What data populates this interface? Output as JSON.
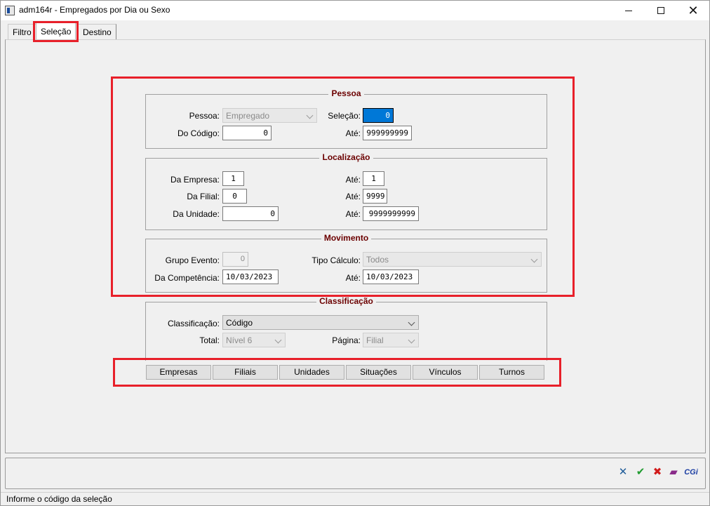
{
  "window": {
    "title": "adm164r - Empregados por Dia ou Sexo"
  },
  "tabs": [
    "Filtro",
    "Seleção",
    "Destino"
  ],
  "pessoa": {
    "title": "Pessoa",
    "pessoa_label": "Pessoa:",
    "pessoa_value": "Empregado",
    "selecao_label": "Seleção:",
    "selecao_value": "0",
    "do_codigo_label": "Do Código:",
    "do_codigo_value": "0",
    "ate_label": "Até:",
    "ate_value": "999999999"
  },
  "localizacao": {
    "title": "Localização",
    "da_empresa_label": "Da Empresa:",
    "da_empresa_value": "1",
    "ate_empresa_label": "Até:",
    "ate_empresa_value": "1",
    "da_filial_label": "Da Filial:",
    "da_filial_value": "0",
    "ate_filial_label": "Até:",
    "ate_filial_value": "9999",
    "da_unidade_label": "Da Unidade:",
    "da_unidade_value": "0",
    "ate_unidade_label": "Até:",
    "ate_unidade_value": "9999999999"
  },
  "movimento": {
    "title": "Movimento",
    "grupo_evento_label": "Grupo Evento:",
    "grupo_evento_value": "0",
    "tipo_calculo_label": "Tipo Cálculo:",
    "tipo_calculo_value": "Todos",
    "da_competencia_label": "Da Competência:",
    "da_competencia_value": "10/03/2023",
    "ate_competencia_label": "Até:",
    "ate_competencia_value": "10/03/2023"
  },
  "classificacao": {
    "title": "Classificação",
    "classificacao_label": "Classificação:",
    "classificacao_value": "Código",
    "total_label": "Total:",
    "total_value": "Nível 6",
    "pagina_label": "Página:",
    "pagina_value": "Filial"
  },
  "buttons": [
    "Empresas",
    "Filiais",
    "Unidades",
    "Situações",
    "Vínculos",
    "Turnos"
  ],
  "toolbar_icons": [
    "excel-icon",
    "confirm-check-icon",
    "cancel-x-icon",
    "help-book-icon",
    "cgi-icon"
  ],
  "toolbar": {
    "cgi_label": "CGi"
  },
  "status": {
    "text": "Informe o código da seleção"
  },
  "colors": {
    "highlight_red": "#e8202a",
    "group_title": "#6b0000",
    "selection_blue": "#0078d7"
  }
}
